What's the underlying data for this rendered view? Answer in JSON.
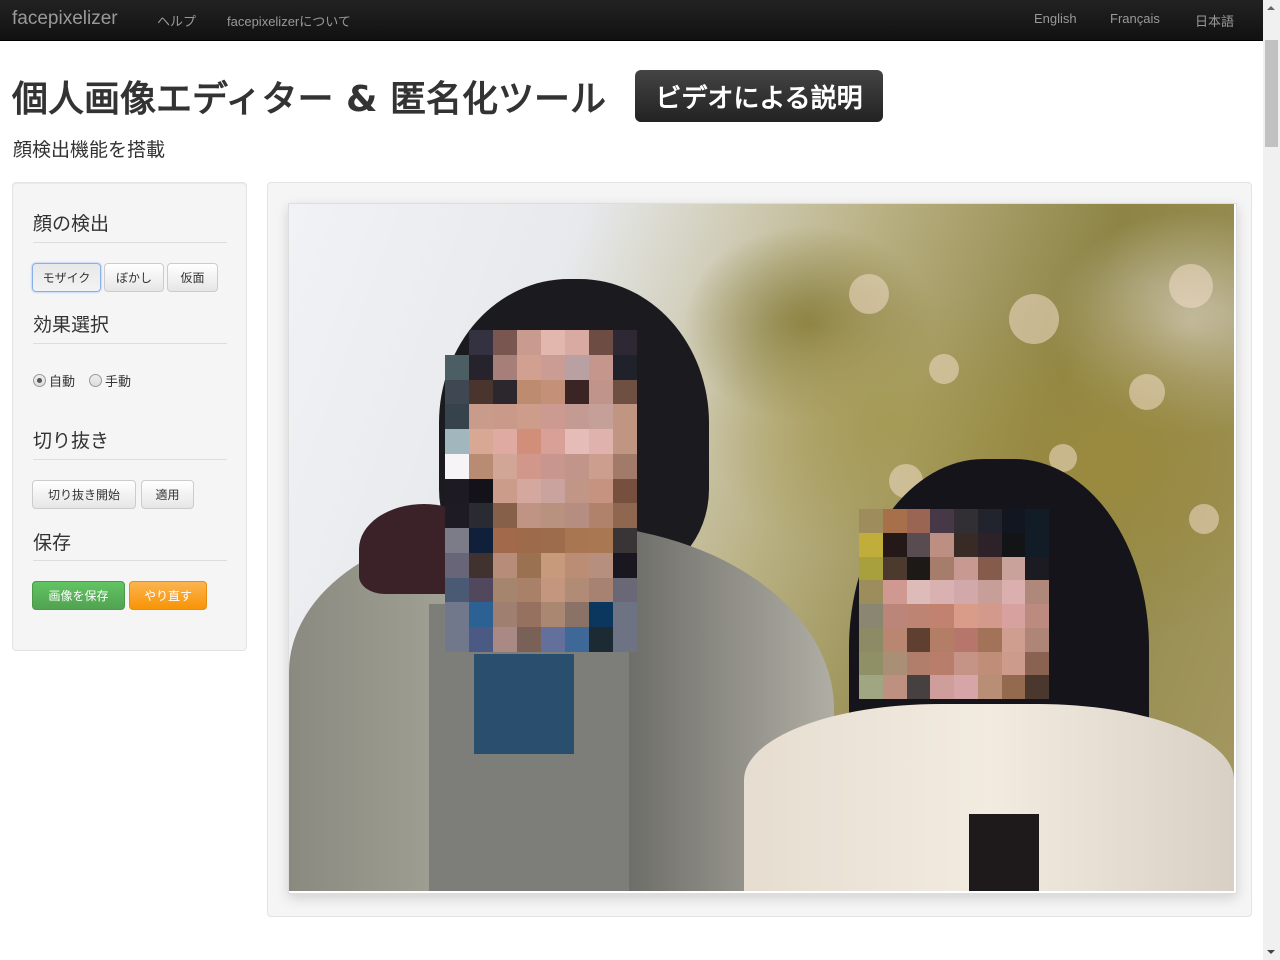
{
  "navbar": {
    "brand": "facepixelizer",
    "links": [
      "ヘルプ",
      "facepixelizerについて"
    ],
    "languages": [
      "English",
      "Français",
      "日本語"
    ]
  },
  "header": {
    "title": "個人画像エディター & 匿名化ツール",
    "video_button": "ビデオによる説明",
    "subtitle": "顔検出機能を搭載"
  },
  "sidebar": {
    "sections": [
      {
        "title": "顔の検出",
        "buttons": [
          {
            "label": "モザイク",
            "active": true
          },
          {
            "label": "ぼかし"
          },
          {
            "label": "仮面"
          }
        ]
      },
      {
        "title": "効果選択",
        "radios": [
          {
            "label": "自動",
            "checked": true
          },
          {
            "label": "手動",
            "checked": false
          }
        ]
      },
      {
        "title": "切り抜き",
        "buttons": [
          {
            "label": "切り抜き開始"
          },
          {
            "label": "適用"
          }
        ]
      },
      {
        "title": "保存",
        "buttons": [
          {
            "label": "画像を保存",
            "style": "success"
          },
          {
            "label": "やり直す",
            "style": "warning"
          }
        ]
      }
    ]
  },
  "canvas": {
    "image_description": "Photo of two people outdoors with pixelated (mosaic) faces",
    "effect": "mosaic",
    "face1_colors": [
      [
        "",
        "#343241",
        "#7a5650",
        "#c99a8e",
        "#e2b8ae",
        "#d9aaa2",
        "#6d4c44",
        "#2e2834"
      ],
      [
        "#4a5e64",
        "#26232c",
        "#a77f79",
        "#d2a091",
        "#cb9c93",
        "#b9a1a3",
        "#c4968c",
        "#1f222a"
      ],
      [
        "#3f4852",
        "#4a342e",
        "#2c262d",
        "#bd8c6f",
        "#c59078",
        "#3a2524",
        "#c1948b",
        "#6d5042"
      ],
      [
        "#37434c",
        "#c89b8a",
        "#c99a8a",
        "#cd9c8b",
        "#cc9a90",
        "#c49b93",
        "#c4a098",
        "#c09683"
      ],
      [
        "#a2b6be",
        "#d8a894",
        "#dfaaa2",
        "#d18f79",
        "#d9a097",
        "#e5bcb8",
        "#dfb2ae",
        "#c09683"
      ],
      [
        "#f6f4f7",
        "#b88c73",
        "#d2a696",
        "#d0978a",
        "#c9968f",
        "#c1958a",
        "#cb9e8e",
        "#a27a6a"
      ],
      [
        "#1d1a24",
        "#141219",
        "#cc9c8b",
        "#d4a89e",
        "#cba39e",
        "#c29686",
        "#c79381",
        "#774f3f"
      ],
      [
        "#1f1b24",
        "#2a2a32",
        "#866048",
        "#c09485",
        "#b8917f",
        "#b58e81",
        "#b0816b",
        "#8f6650"
      ],
      [
        "#7b7c88",
        "#10203a",
        "#a2694a",
        "#9e6a4c",
        "#9d6c4c",
        "#a97652",
        "#aa7753",
        "#393537"
      ],
      [
        "#676577",
        "#40322e",
        "#b78c78",
        "#9a7252",
        "#c79a7c",
        "#ba8d74",
        "#b78f7e",
        "#1b1721"
      ],
      [
        "#4a5a74",
        "#51485d",
        "#a6856f",
        "#a98068",
        "#c3967d",
        "#b18b75",
        "#a78272",
        "#6a6876"
      ],
      [
        "#72788c",
        "#2c6193",
        "#9e7f70",
        "#96715f",
        "#a98770",
        "#8b7266",
        "#0b365e",
        "#6e7384"
      ],
      [
        "#72788c",
        "#4a5a84",
        "#a88983",
        "#7a6158",
        "#63709c",
        "#3e6897",
        "#1c2a34",
        "#6e7384"
      ]
    ],
    "face2_colors": [
      [
        "#9f8c5c",
        "#a86f4b",
        "#9a6552",
        "#473847",
        "#322f34",
        "#22242d",
        "#121621",
        "#111c26"
      ],
      [
        "#c0ad3c",
        "#241818",
        "#584c50",
        "#bc8f82",
        "#382a25",
        "#2d2227",
        "#121416",
        "#111c26"
      ],
      [
        "#a8a03c",
        "#4b3a2d",
        "#1c1916",
        "#a67c6a",
        "#c79991",
        "#855b4c",
        "#c9a29c",
        "#1c1b22"
      ],
      [
        "#9d8c5c",
        "#cf9891",
        "#ddbbb9",
        "#d8b1b0",
        "#d2a9ab",
        "#c89f98",
        "#dbafae",
        "#af887c"
      ],
      [
        "#8b8672",
        "#bb857a",
        "#bd8473",
        "#c1826f",
        "#d89c88",
        "#d3998b",
        "#d6a19f",
        "#bc8a7e"
      ],
      [
        "#8d8a66",
        "#b88671",
        "#5f4030",
        "#b47e66",
        "#b7766c",
        "#a27259",
        "#d09e8f",
        "#ae8576"
      ],
      [
        "#909066",
        "#a88f76",
        "#b07e6a",
        "#b87d6b",
        "#c59487",
        "#c08d78",
        "#cc9b8b",
        "#8a6252"
      ],
      [
        "#a0a682",
        "#be9080",
        "#474040",
        "#cf9e9b",
        "#d5a5a7",
        "#b88e76",
        "#946a4f",
        "#4a382e"
      ]
    ]
  }
}
